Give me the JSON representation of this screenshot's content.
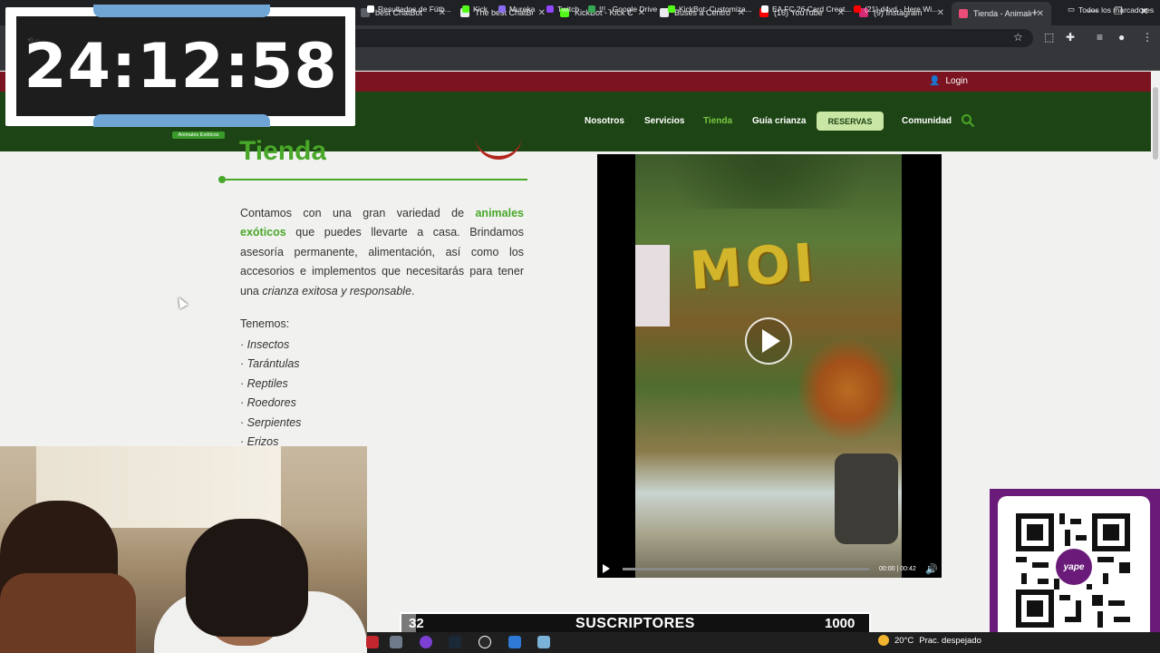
{
  "browser": {
    "tabs": [
      {
        "label": "best ChatBot",
        "color": "#5b5f66"
      },
      {
        "label": "The best ChatBot",
        "color": "#e8eaed"
      },
      {
        "label": "KickBot - Kick Cha",
        "color": "#53fc18"
      },
      {
        "label": "Buses a Centro de",
        "color": "#e8eaed"
      },
      {
        "label": "(16) YouTube",
        "color": "#ff0000"
      },
      {
        "label": "(9) Instagram",
        "color": "#d62976"
      },
      {
        "label": "Tienda - Animales",
        "color": "#e94d78",
        "active": true
      }
    ],
    "url": "animales-exoticos.pe/tienda/",
    "bookmarks": [
      {
        "label": "Resultados de Fútb...",
        "color": "#ffffff"
      },
      {
        "label": "Kick",
        "color": "#53fc18"
      },
      {
        "label": "Mureka",
        "color": "#8a6df0"
      },
      {
        "label": "Twitch",
        "color": "#9146ff"
      },
      {
        "label": "!!! - Google Drive",
        "color": "#34a853"
      },
      {
        "label": "KickBot: Customiza...",
        "color": "#53fc18"
      },
      {
        "label": "EA FC 26 Card Creat...",
        "color": "#ffffff"
      },
      {
        "label": "(21) d4vd - Here Wi...",
        "color": "#ff0000"
      }
    ],
    "all_bookmarks": "Todos los marcadores",
    "icons": [
      "star-icon",
      "extensions-icon",
      "profile-icon",
      "menu-icon"
    ]
  },
  "site": {
    "login": "Login",
    "nav": [
      "Nosotros",
      "Servicios",
      "Tienda",
      "Guía crianza",
      "RESERVAS",
      "Comunidad"
    ],
    "logo_badge": "Animales Exóticos",
    "logo_text": "MOI",
    "title": "Tienda",
    "intro": {
      "p1": "Contamos con una gran variedad de ",
      "hl": "animales exóticos",
      "p2": " que puedes llevarte a casa. Brindamos asesoría permanente, alimentación, así como los accesorios e implementos que necesitarás para tener una ",
      "em": "crianza exitosa y responsable",
      "p3": "."
    },
    "tenemos": "Tenemos:",
    "list": [
      "Insectos",
      "Tarántulas",
      "Reptiles",
      "Roedores",
      "Serpientes",
      "Erizos"
    ],
    "video": {
      "time": "00:00 | 00:42",
      "sign": "MOI"
    }
  },
  "overlay": {
    "timer": "24:12:58",
    "subs": {
      "current": "32",
      "label": "SUSCRIPTORES",
      "goal": "1000"
    },
    "qr_brand": "yape"
  },
  "taskbar": {
    "temp": "20°C",
    "weather": "Prac. despejado"
  },
  "colors": {
    "accent_green": "#49a72a",
    "nav_green": "#1d4414",
    "topbar_red": "#7b1320"
  }
}
